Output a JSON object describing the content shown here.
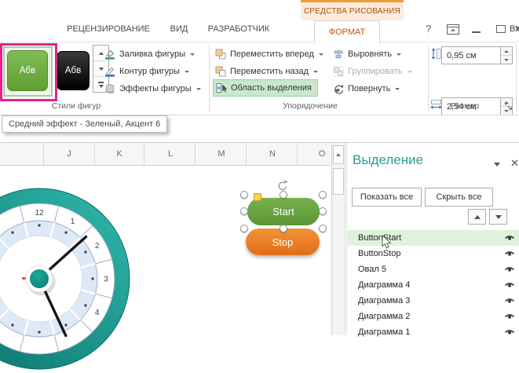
{
  "window": {
    "contextual_tab": "СРЕДСТВА РИСОВАНИЯ",
    "help_glyph": "?",
    "signin": "Вход"
  },
  "tabs": {
    "review": "РЕЦЕНЗИРОВАНИЕ",
    "view": "ВИД",
    "developer": "РАЗРАБОТЧИК",
    "format": "ФОРМАТ"
  },
  "ribbon": {
    "shape_styles": {
      "label": "Стили фигур",
      "swatch_green": "Абв",
      "swatch_black": "Абв",
      "fill": "Заливка фигуры",
      "outline": "Контур фигуры",
      "effects": "Эффекты фигуры"
    },
    "arrange": {
      "label": "Упорядочение",
      "bring_forward": "Переместить вперед",
      "send_backward": "Переместить назад",
      "selection_pane": "Область выделения",
      "align": "Выровнять",
      "group": "Группировать",
      "rotate": "Повернуть"
    },
    "size": {
      "label": "Размер",
      "height_value": "0,95 см",
      "width_value": "2,54 см"
    }
  },
  "tooltip": "Средний эффект - Зеленый, Акцент 6",
  "sheet": {
    "columns": [
      "J",
      "K",
      "L",
      "M",
      "N",
      "O"
    ]
  },
  "canvas": {
    "start_button": "Start",
    "stop_button": "Stop",
    "clock_numbers": [
      "12",
      "1",
      "2",
      "3",
      "4"
    ]
  },
  "selection_pane": {
    "title": "Выделение",
    "show_all": "Показать все",
    "hide_all": "Скрыть все",
    "selected_item": "ButtonStart",
    "items": [
      "ButtonStart",
      "ButtonStop",
      "Овал 5",
      "Диаграмма 4",
      "Диаграмма 3",
      "Диаграмма 2",
      "Диаграмма 1"
    ]
  },
  "colors": {
    "contextual_orange": "#EF9C35",
    "active_tab_text": "#C0560E",
    "pane_title_teal": "#2B9D8E",
    "ribbon_highlight_green": "#C9E7CA",
    "row_highlight_green": "#DFF3DB",
    "shape_green": "#6CA844",
    "shape_orange": "#ED7D23",
    "clock_teal": "#12948A",
    "annotation_pink": "#E81F8F"
  }
}
